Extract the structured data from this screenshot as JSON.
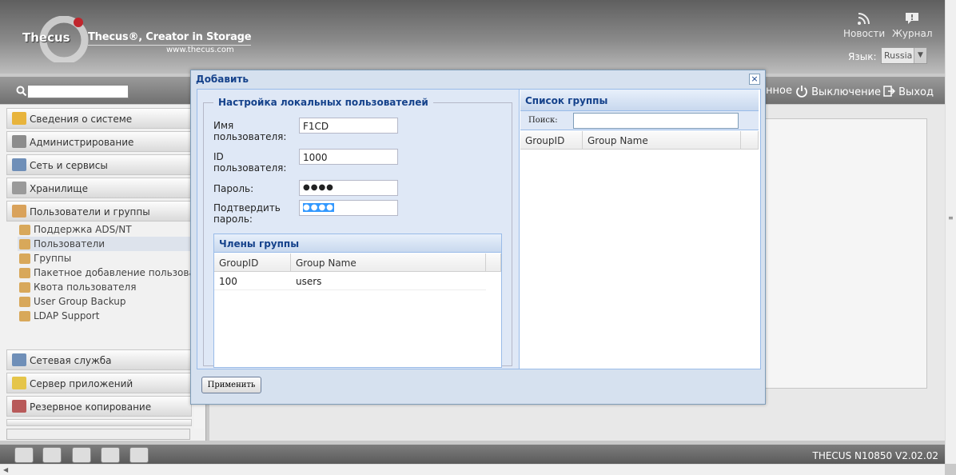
{
  "header": {
    "logo_text": "Thecus",
    "tagline": "Thecus®, Creator in Storage",
    "website": "www.thecus.com",
    "news_label": "Новости",
    "journal_label": "Журнал",
    "language_label": "Язык:",
    "language_value": "Russia"
  },
  "toolbar": {
    "partial_label": "нное",
    "shutdown_label": "Выключение",
    "logout_label": "Выход"
  },
  "sidebar": {
    "sections_top": [
      {
        "label": "Сведения о системе",
        "icon": "info-icon",
        "color": "#e8b43c"
      },
      {
        "label": "Администрирование",
        "icon": "tools-icon",
        "color": "#8c8c8c"
      },
      {
        "label": "Сеть и сервисы",
        "icon": "network-icon",
        "color": "#6f8fb8"
      },
      {
        "label": "Хранилище",
        "icon": "storage-icon",
        "color": "#9a9a9a"
      },
      {
        "label": "Пользователи и группы",
        "icon": "users-icon",
        "color": "#d9a25b"
      }
    ],
    "sub_items": [
      "Поддержка ADS/NT",
      "Пользователи",
      "Группы",
      "Пакетное добавление пользователей",
      "Квота пользователя",
      "User Group Backup",
      "LDAP Support"
    ],
    "sections_bottom": [
      {
        "label": "Сетевая служба",
        "icon": "network-service-icon",
        "color": "#6f8fb8"
      },
      {
        "label": "Сервер приложений",
        "icon": "app-server-icon",
        "color": "#e5c54a"
      },
      {
        "label": "Резервное копирование",
        "icon": "backup-icon",
        "color": "#b85a5a"
      }
    ]
  },
  "statusbar": {
    "version": "THECUS N10850 V2.02.02"
  },
  "dialog": {
    "title": "Добавить",
    "close": "×",
    "fieldset_legend": "Настройка локальных пользователей",
    "fields": {
      "username_label_1": "Имя",
      "username_label_2": "пользователя:",
      "username_value": "F1CD",
      "uid_label_1": "ID",
      "uid_label_2": "пользователя:",
      "uid_value": "1000",
      "password_label": "Пароль:",
      "password_value": "●●●●",
      "confirm_label_1": "Подтвердить",
      "confirm_label_2": "пароль:",
      "confirm_value": "●●●●"
    },
    "members": {
      "title": "Члены группы",
      "columns": [
        "GroupID",
        "Group Name"
      ],
      "rows": [
        [
          "100",
          "users"
        ]
      ]
    },
    "group_list": {
      "title": "Список группы",
      "search_label": "Поиск:",
      "search_value": "",
      "columns": [
        "GroupID",
        "Group Name"
      ]
    },
    "apply_button": "Применить"
  }
}
